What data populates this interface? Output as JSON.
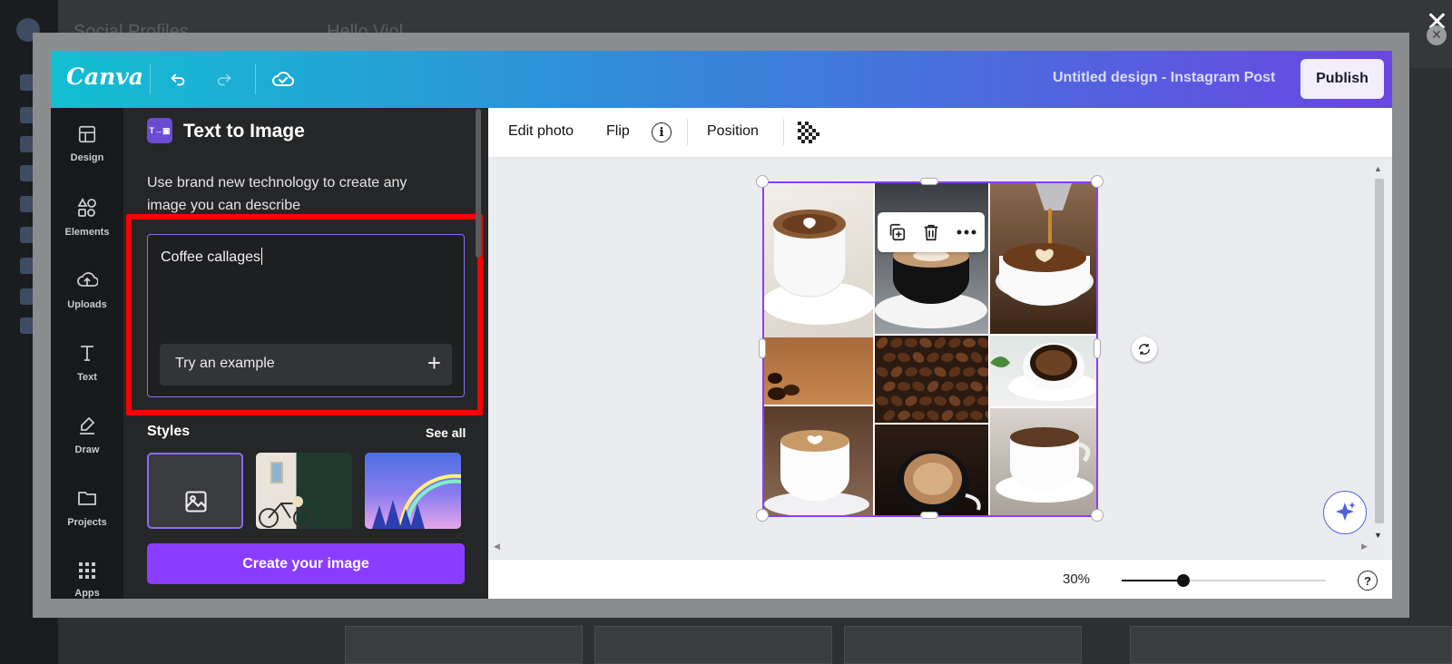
{
  "background_app": {
    "header_title": "Social Profiles",
    "header_greeting": "Hello Viol"
  },
  "app": {
    "logo": "Canva",
    "design_title": "Untitled design - Instagram Post",
    "publish_label": "Publish",
    "accent": "#8b3dff"
  },
  "rail": {
    "items": [
      {
        "label": "Design",
        "icon": "design-icon"
      },
      {
        "label": "Elements",
        "icon": "elements-icon"
      },
      {
        "label": "Uploads",
        "icon": "uploads-icon"
      },
      {
        "label": "Text",
        "icon": "text-icon"
      },
      {
        "label": "Draw",
        "icon": "draw-icon"
      },
      {
        "label": "Projects",
        "icon": "projects-icon"
      },
      {
        "label": "Apps",
        "icon": "apps-icon"
      }
    ]
  },
  "panel": {
    "title": "Text to Image",
    "description": "Use brand new technology to create any image you can describe",
    "prompt_value": "Coffee callages",
    "try_example": "Try an example",
    "styles_heading": "Styles",
    "see_all": "See all",
    "create_button": "Create your image"
  },
  "context_toolbar": {
    "edit_photo": "Edit photo",
    "flip": "Flip",
    "position": "Position"
  },
  "footer": {
    "zoom_label": "30%",
    "zoom_level": 0.3,
    "help": "?"
  }
}
